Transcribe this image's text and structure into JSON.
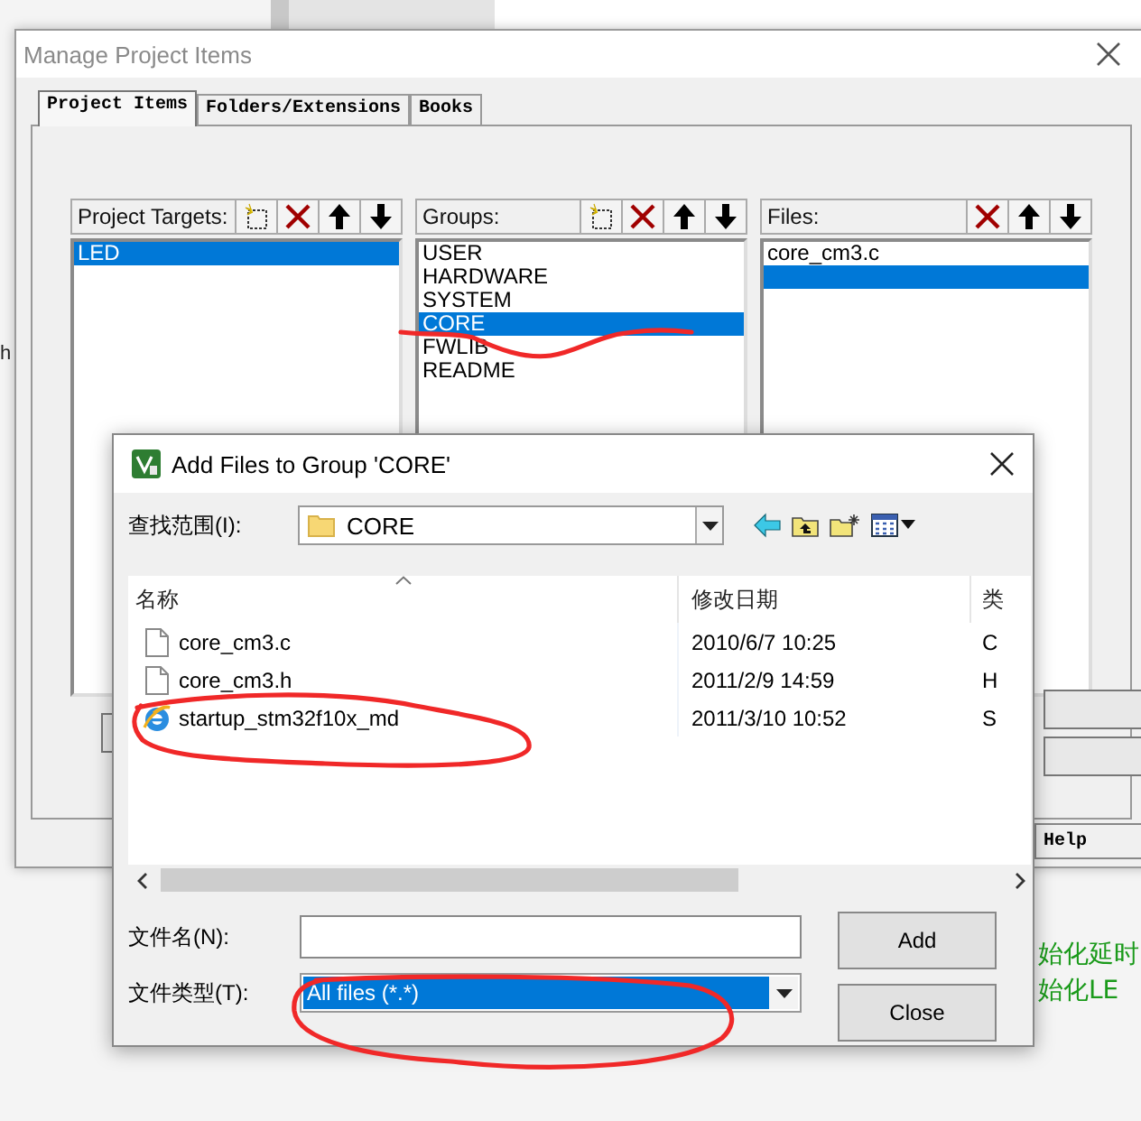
{
  "background_editor": {
    "left_fragment": "h",
    "right_lines": [
      "始化延时",
      "始化LE"
    ]
  },
  "manage_dialog": {
    "title": "Manage Project Items",
    "tabs": [
      {
        "label": "Project Items",
        "selected": true
      },
      {
        "label": "Folders/Extensions",
        "selected": false
      },
      {
        "label": "Books",
        "selected": false
      }
    ],
    "panels": [
      {
        "label": "Project Targets:",
        "tools": [
          {
            "kind": "new"
          },
          {
            "kind": "delete"
          },
          {
            "kind": "up"
          },
          {
            "kind": "down"
          }
        ],
        "items": [
          {
            "text": "LED",
            "selected": true
          }
        ]
      },
      {
        "label": "Groups:",
        "tools": [
          {
            "kind": "new"
          },
          {
            "kind": "delete"
          },
          {
            "kind": "up"
          },
          {
            "kind": "down"
          }
        ],
        "items": [
          {
            "text": "USER",
            "selected": false
          },
          {
            "text": "HARDWARE",
            "selected": false
          },
          {
            "text": "SYSTEM",
            "selected": false
          },
          {
            "text": "CORE",
            "selected": true
          },
          {
            "text": "FWLIB",
            "selected": false
          },
          {
            "text": "README",
            "selected": false
          }
        ]
      },
      {
        "label": "Files:",
        "tools": [
          {
            "kind": "delete"
          },
          {
            "kind": "up"
          },
          {
            "kind": "down"
          }
        ],
        "items": [
          {
            "text": "core_cm3.c",
            "selected": false
          }
        ],
        "blank_selected_row": true
      }
    ],
    "help_button": "Help"
  },
  "add_dialog": {
    "title": "Add Files to Group 'CORE'",
    "look_in_label": "查找范围(I):",
    "look_in_value": "CORE",
    "columns": [
      "名称",
      "修改日期",
      "类"
    ],
    "rows": [
      {
        "kind": "document",
        "name": "core_cm3.c",
        "date": "2010/6/7 10:25",
        "type": "C"
      },
      {
        "kind": "document",
        "name": "core_cm3.h",
        "date": "2011/2/9 14:59",
        "type": "H"
      },
      {
        "kind": "browser",
        "name": "startup_stm32f10x_md",
        "date": "2011/3/10 10:52",
        "type": "S"
      }
    ],
    "file_name_label": "文件名(N):",
    "file_type_label": "文件类型(T):",
    "file_type": "All files (*.*)",
    "buttons": [
      "Add",
      "Close"
    ]
  }
}
